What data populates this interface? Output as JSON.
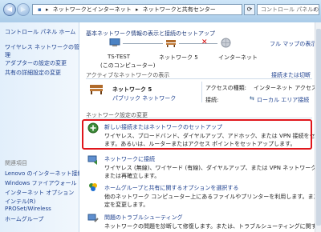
{
  "address": {
    "segments": [
      "ネットワークとインターネット",
      "ネットワークと共有センター"
    ],
    "search_placeholder": "コントロール パネルの検索"
  },
  "sidebar": {
    "items": [
      "コントロール パネル ホーム",
      "ワイヤレス ネットワークの管",
      "理",
      "アダプターの設定の変更",
      "共有の詳細設定の変更"
    ],
    "see_also_heading": "関連項目",
    "see_also": [
      "Lenovo のインターネット接続",
      "Windows ファイアウォール",
      "インターネット オプション",
      "インテル(R)",
      "PROSet/Wireless",
      "ホームグループ"
    ]
  },
  "main": {
    "heading": "基本ネットワーク情報の表示と接続のセットアップ",
    "full_map": "フル マップの表示",
    "map": {
      "computer_label": "TS-TEST",
      "computer_sub": "(このコンピューター)",
      "network_label": "ネットワーク 5",
      "internet_label": "インターネット"
    },
    "active_heading": "アクティブなネットワークの表示",
    "connect_disconnect": "接続または切断",
    "network": {
      "name": "ネットワーク 5",
      "type": "パブリック ネットワーク",
      "access_label": "アクセスの種類:",
      "access_value": "インターネット アクセスなし",
      "conn_label": "接続:",
      "conn_value": "ローカル エリア接続"
    },
    "change_heading": "ネットワーク設定の変更",
    "tasks": [
      {
        "title": "新しい接続またはネットワークのセットアップ",
        "desc1": "ワイヤレス、ブロードバンド、ダイヤルアップ、アドホック、または VPN 接続をセットアップし",
        "desc2": "ます。あるいは、ルーターまたはアクセス ポイントをセットアップします。"
      },
      {
        "title": "ネットワークに接続",
        "desc1": "ワイヤレス (無線)、ワイヤード (有線)、ダイヤルアップ、または VPN ネットワーク接続を確立",
        "desc2": "または再確立します。"
      },
      {
        "title": "ホームグループと共有に関するオプションを選択する",
        "desc1": "他のネットワーク コンピューター上にあるファイルやプリンターを利用します。または、共有設",
        "desc2": "定を変更します。"
      },
      {
        "title": "問題のトラブルシューティング",
        "desc1": "ネットワークの問題を診断して修復します。または、トラブルシューティングに関する情報を",
        "desc2": ""
      }
    ]
  }
}
